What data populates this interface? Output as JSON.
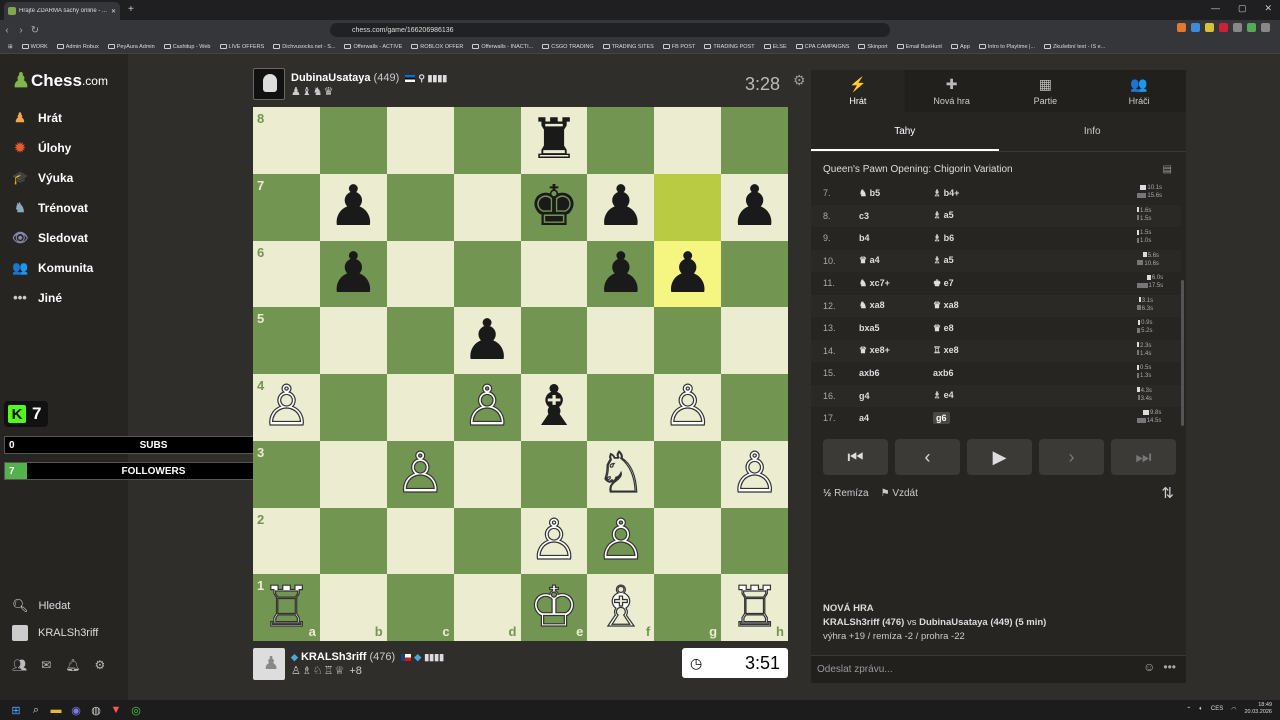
{
  "browser": {
    "tab_title": "Hrajte ZDARMA šachy online - ...",
    "url": "chess.com/game/166206986136",
    "bookmarks": [
      "WORK",
      "Admin Robux",
      "PeyAura Admin",
      "Cashitup - Web",
      "LIVE OFFERS",
      "Dichvusocks.net - S...",
      "Offerwalls - ACTIVE",
      "ROBLOX OFFER",
      "Offerwalls - INACTI...",
      "CSGO TRADING",
      "TRADING SITES",
      "FB POST",
      "TRADING POST",
      "ELSE",
      "CPA CAMPAIGNS",
      "Skinport",
      "Email BuxHunt",
      "App",
      "Intro to Playtime |...",
      "Zkušební text - IS e..."
    ]
  },
  "sidebar": {
    "logo": "Chess",
    "logo_suffix": ".com",
    "items": [
      {
        "label": "Hrát",
        "icon": "♟"
      },
      {
        "label": "Úlohy",
        "icon": "✹"
      },
      {
        "label": "Výuka",
        "icon": "🎓"
      },
      {
        "label": "Trénovat",
        "icon": "♞"
      },
      {
        "label": "Sledovat",
        "icon": "👁"
      },
      {
        "label": "Komunita",
        "icon": "👥"
      },
      {
        "label": "Jiné",
        "icon": "•••"
      }
    ],
    "search": "Hledat",
    "user": "KRALSh3riff"
  },
  "overlay": {
    "kick_count": "7",
    "subs": {
      "current": "0",
      "label": "SUBS",
      "goal": "10",
      "fraction": 0.0
    },
    "followers": {
      "current": "7",
      "label": "FOLLOWERS",
      "goal": "100",
      "fraction": 0.07
    }
  },
  "top_player": {
    "name": "DubinaUsataya",
    "rating": "(449)",
    "captured": "♟♝♞♛",
    "clock": "3:28"
  },
  "bottom_player": {
    "name": "KRALSh3riff",
    "rating": "(476)",
    "captured": "♙♗♘♖♕",
    "advantage": "+8",
    "clock": "3:51"
  },
  "board": {
    "ranks": [
      "8",
      "7",
      "6",
      "5",
      "4",
      "3",
      "2",
      "1"
    ],
    "files": [
      "a",
      "b",
      "c",
      "d",
      "e",
      "f",
      "g",
      "h"
    ],
    "position": [
      [
        "",
        "",
        "",
        "",
        "♜",
        "",
        "",
        ""
      ],
      [
        "",
        "♟",
        "",
        "",
        "♚",
        "♟",
        "",
        "♟"
      ],
      [
        "",
        "♟",
        "",
        "",
        "",
        "♟",
        "♟",
        ""
      ],
      [
        "",
        "",
        "",
        "♟",
        "",
        "",
        "",
        ""
      ],
      [
        "♙",
        "",
        "",
        "♙",
        "♝",
        "",
        "♙",
        ""
      ],
      [
        "",
        "",
        "♙",
        "",
        "",
        "♘",
        "",
        "♙"
      ],
      [
        "",
        "",
        "",
        "",
        "♙",
        "♙",
        "",
        ""
      ],
      [
        "♖",
        "",
        "",
        "",
        "♔",
        "♗",
        "",
        "♖"
      ]
    ],
    "highlight_squares": [
      "g7",
      "g6"
    ]
  },
  "panel": {
    "tabs": [
      {
        "label": "Hrát",
        "icon": "⚡"
      },
      {
        "label": "Nová hra",
        "icon": "✚"
      },
      {
        "label": "Partie",
        "icon": "▦"
      },
      {
        "label": "Hráči",
        "icon": "👥"
      }
    ],
    "subtabs": [
      "Tahy",
      "Info"
    ],
    "opening": "Queen's Pawn Opening: Chigorin Variation",
    "moves": [
      {
        "no": "7.",
        "w": "♞ b5",
        "b": "♗ b4+",
        "tw": "10.1s",
        "tb": "15.6s"
      },
      {
        "no": "8.",
        "w": "c3",
        "b": "♗ a5",
        "tw": "1.6s",
        "tb": "1.5s"
      },
      {
        "no": "9.",
        "w": "b4",
        "b": "♗ b6",
        "tw": "1.5s",
        "tb": "1.0s"
      },
      {
        "no": "10.",
        "w": "♛ a4",
        "b": "♗ a5",
        "tw": "5.6s",
        "tb": "10.6s"
      },
      {
        "no": "11.",
        "w": "♞ xc7+",
        "b": "♚ e7",
        "tw": "6.0s",
        "tb": "17.5s"
      },
      {
        "no": "12.",
        "w": "♞ xa8",
        "b": "♛ xa8",
        "tw": "3.1s",
        "tb": "6.3s"
      },
      {
        "no": "13.",
        "w": "bxa5",
        "b": "♛ e8",
        "tw": "0.9s",
        "tb": "5.2s"
      },
      {
        "no": "14.",
        "w": "♛ xe8+",
        "b": "♖ xe8",
        "tw": "2.3s",
        "tb": "1.4s"
      },
      {
        "no": "15.",
        "w": "axb6",
        "b": "axb6",
        "tw": "0.5s",
        "tb": "1.3s"
      },
      {
        "no": "16.",
        "w": "g4",
        "b": "♗ e4",
        "tw": "4.3s",
        "tb": "3.4s"
      },
      {
        "no": "17.",
        "w": "a4",
        "b": "g6",
        "tw": "9.8s",
        "tb": "14.5s"
      }
    ],
    "draw": "Remíza",
    "resign": "Vzdát",
    "new_game_title": "NOVÁ HRA",
    "new_game_white": "KRALSh3riff (476)",
    "new_game_vs": "vs",
    "new_game_black": "DubinaUsataya (449) (5 min)",
    "stats": "výhra +19 / remíza -2 / prohra -22",
    "message_placeholder": "Odeslat zprávu..."
  },
  "taskbar": {
    "lang": "CES",
    "time": "18:49",
    "date": "20.03.2026"
  },
  "colors": {
    "light": "#ebecd0",
    "dark": "#739552",
    "accent": "#81b64c",
    "kick": "#53fc18"
  }
}
